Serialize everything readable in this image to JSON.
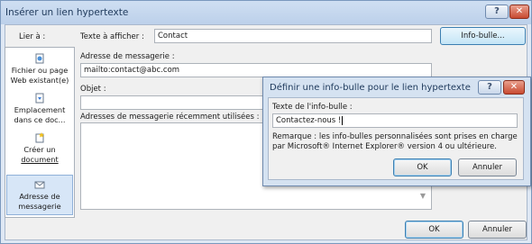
{
  "dialog": {
    "title": "Insérer un lien hypertexte",
    "help_glyph": "?",
    "close_glyph": "✕"
  },
  "sidebar": {
    "label": "Lier à :",
    "items": [
      {
        "line1": "Fichier ou page",
        "line2": "Web existant(e)",
        "icon": "globe-page-icon",
        "selected": false
      },
      {
        "line1": "Emplacement",
        "line2": "dans ce doc...",
        "icon": "document-place-icon",
        "selected": false
      },
      {
        "line1": "Créer un",
        "line2": "document",
        "icon": "new-document-icon",
        "selected": false
      },
      {
        "line1": "Adresse de",
        "line2": "messagerie",
        "icon": "email-address-icon",
        "selected": true
      }
    ]
  },
  "form": {
    "display_text_label": "Texte à afficher :",
    "display_text_value": "Contact",
    "tooltip_button": "Info-bulle...",
    "email_label": "Adresse de messagerie :",
    "email_value": "mailto:contact@abc.com",
    "subject_label": "Objet :",
    "subject_value": "",
    "recent_label": "Adresses de messagerie récemment utilisées :",
    "recent_items": []
  },
  "footer": {
    "ok": "OK",
    "cancel": "Annuler"
  },
  "tooltip_dialog": {
    "title": "Définir une info-bulle pour le lien hypertexte",
    "help_glyph": "?",
    "close_glyph": "✕",
    "field_label": "Texte de l'info-bulle :",
    "field_value": "Contactez-nous !",
    "note": "Remarque : les info-bulles personnalisées sont prises en charge par Microsoft® Internet Explorer® version 4 ou ultérieure.",
    "ok": "OK",
    "cancel": "Annuler"
  },
  "colors": {
    "title_bar": "#bcd0ea",
    "close_button": "#c84a31",
    "selected_item": "#d7e6f7"
  }
}
